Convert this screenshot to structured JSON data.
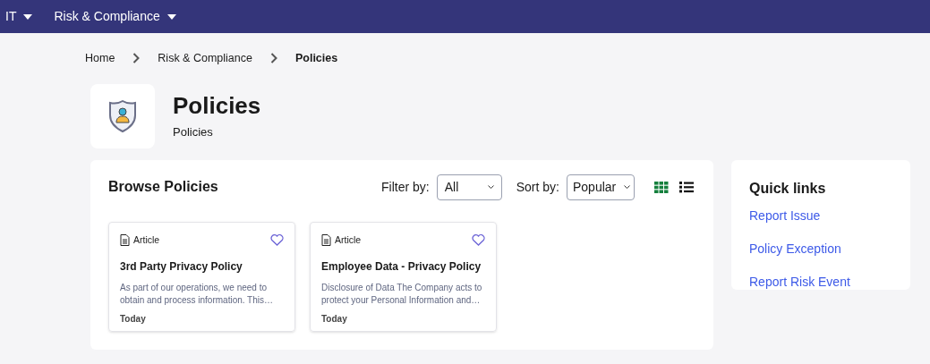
{
  "nav": [
    {
      "label": "IT"
    },
    {
      "label": "Risk & Compliance"
    }
  ],
  "breadcrumb": [
    {
      "label": "Home",
      "current": false
    },
    {
      "label": "Risk & Compliance",
      "current": false
    },
    {
      "label": "Policies",
      "current": true
    }
  ],
  "header": {
    "title": "Policies",
    "subtitle": "Policies"
  },
  "browse": {
    "title": "Browse Policies",
    "filter": {
      "label": "Filter by:",
      "value": "All"
    },
    "sort": {
      "label": "Sort by:",
      "value": "Popular"
    },
    "views": [
      {
        "kind": "grid",
        "selected": true
      },
      {
        "kind": "list",
        "selected": false
      }
    ],
    "cards": [
      {
        "type": "Article",
        "title": "3rd Party Privacy Policy",
        "excerpt": "As part of our operations, we need to obtain and process information. This…",
        "date": "Today"
      },
      {
        "type": "Article",
        "title": "Employee Data - Privacy Policy",
        "excerpt": "Disclosure of Data The Company acts to protect your Personal Information and…",
        "date": "Today"
      }
    ]
  },
  "quick_links": {
    "title": "Quick links",
    "links": [
      "Report Issue",
      "Policy Exception",
      "Report Risk Event"
    ]
  }
}
